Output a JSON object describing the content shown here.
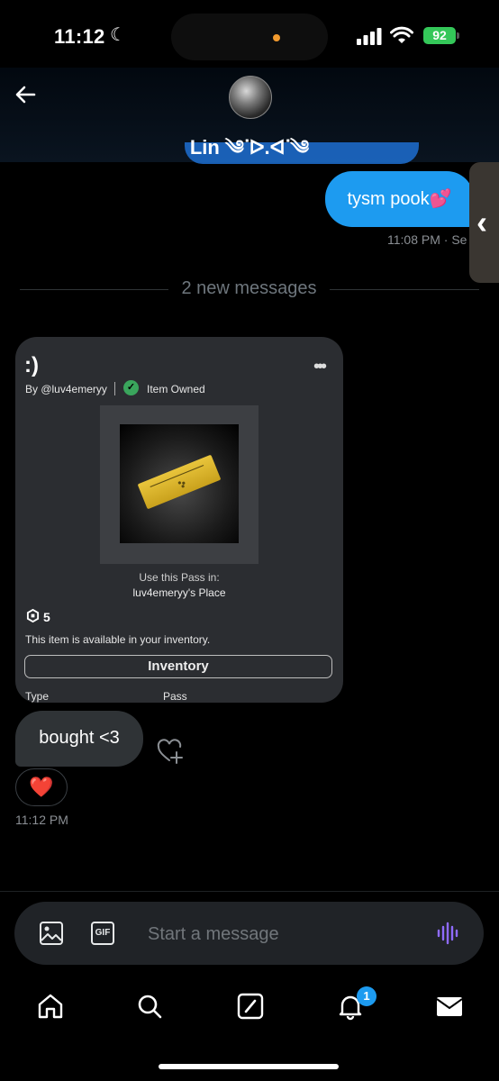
{
  "status_bar": {
    "time": "11:12",
    "battery": "92"
  },
  "header": {
    "back_icon": "arrow-left-icon",
    "contact_name": "Lin ༄ᐝᐅ.ᐊᐝ༄"
  },
  "outgoing": {
    "text": "tysm pook💕",
    "meta": "11:08 PM · Se"
  },
  "divider": {
    "label": "2 new messages"
  },
  "shared_item": {
    "face": ":)",
    "more_label": "•••",
    "by_label": "By @luv4emeryy",
    "owned_label": "Item Owned",
    "use_label": "Use this Pass in:",
    "place_label": "luv4emeryy's Place",
    "price": "5",
    "availability": "This item is available in your inventory.",
    "inventory_button": "Inventory",
    "type_label": "Type",
    "type_value": "Pass"
  },
  "incoming": {
    "text": "bought <3",
    "reaction": "❤️",
    "time": "11:12 PM"
  },
  "composer": {
    "gif_label": "GIF",
    "placeholder": "Start a message"
  },
  "nav": {
    "notification_count": "1"
  },
  "colors": {
    "accent": "#1d9bf0",
    "bubble_in": "#2f3336",
    "card_bg": "#2b2d31",
    "owned_green": "#3aa55c",
    "ticket_gold": "#e1bc33"
  }
}
